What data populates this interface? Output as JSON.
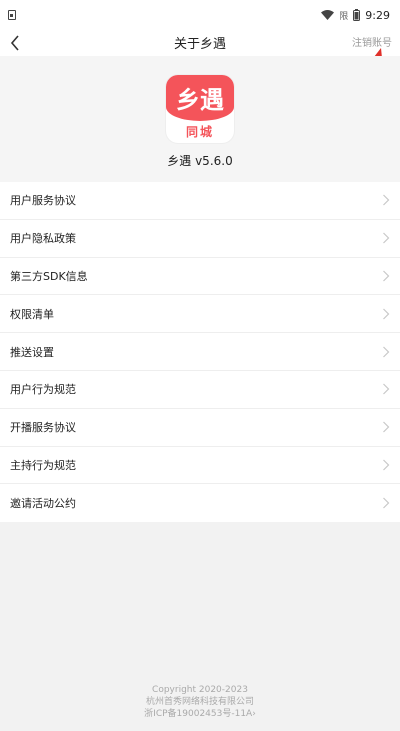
{
  "status_bar": {
    "time": "9:29",
    "signal_label": "限"
  },
  "header": {
    "title": "关于乡遇",
    "right_action": "注销账号"
  },
  "app": {
    "logo_text": "乡遇",
    "logo_subtext": "同城",
    "version": "乡遇 v5.6.0"
  },
  "menu": {
    "items": [
      {
        "label": "用户服务协议"
      },
      {
        "label": "用户隐私政策"
      },
      {
        "label": "第三方SDK信息"
      },
      {
        "label": "权限清单"
      },
      {
        "label": "推送设置"
      },
      {
        "label": "用户行为规范"
      },
      {
        "label": "开播服务协议"
      },
      {
        "label": "主持行为规范"
      },
      {
        "label": "邀请活动公约"
      }
    ]
  },
  "footer": {
    "copyright": "Copyright 2020-2023",
    "company": "杭州首秀网络科技有限公司",
    "icp": "浙ICP备19002453号-11A"
  },
  "colors": {
    "brand": "#f4545a",
    "annotation_arrow": "#e0302a"
  }
}
